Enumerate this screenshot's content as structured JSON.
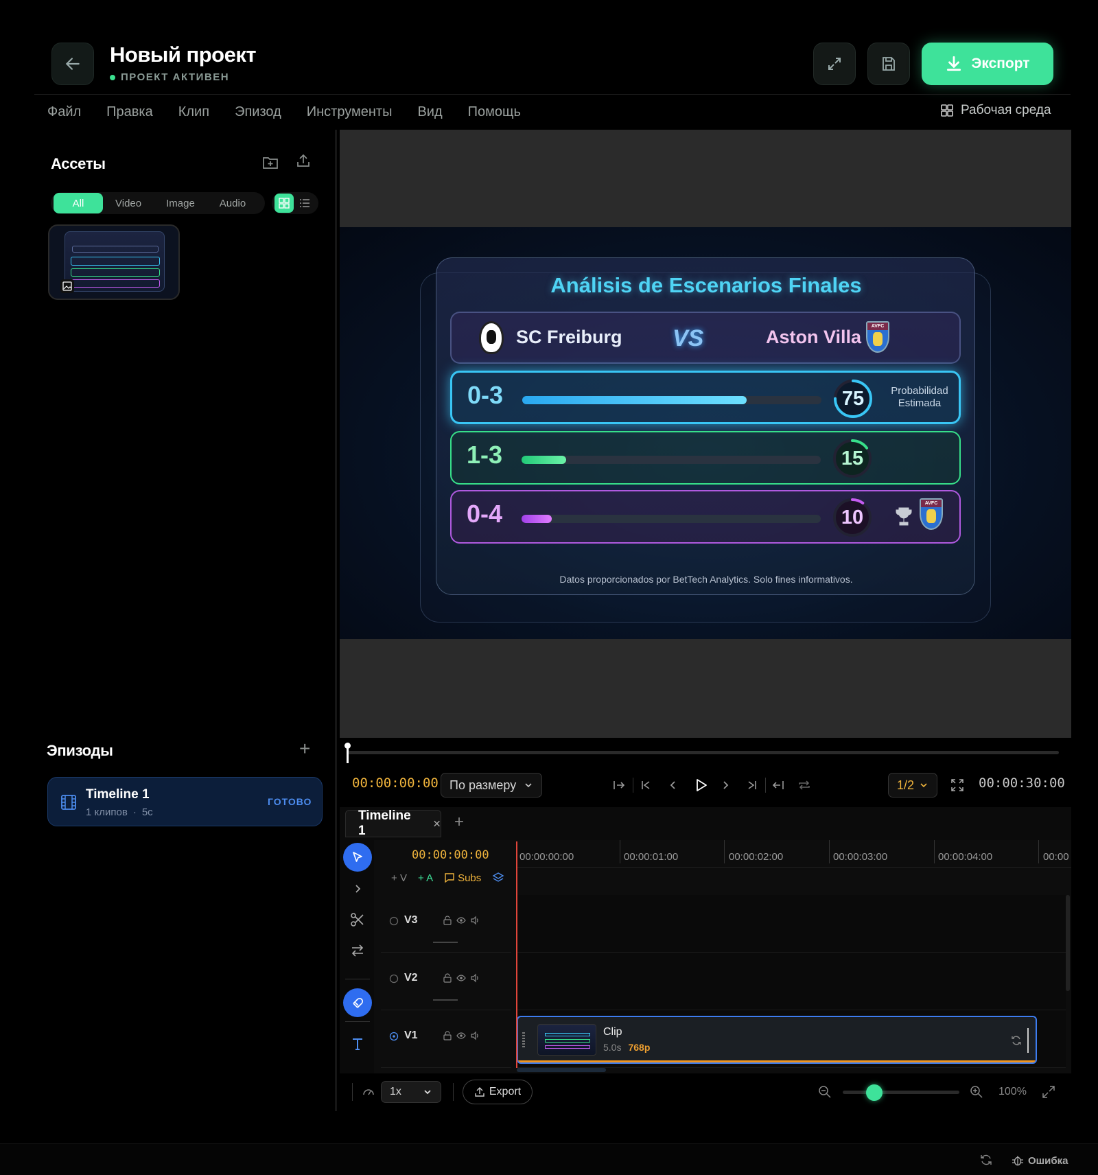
{
  "header": {
    "title": "Новый проект",
    "status": "ПРОЕКТ АКТИВЕН",
    "export_label": "Экспорт"
  },
  "menu": [
    "Файл",
    "Правка",
    "Клип",
    "Эпизод",
    "Инструменты",
    "Вид",
    "Помощь"
  ],
  "workspace_label": "Рабочая среда",
  "assets": {
    "title": "Ассеты",
    "filters": [
      "All",
      "Video",
      "Image",
      "Audio"
    ],
    "active_filter": "All"
  },
  "episodes": {
    "title": "Эпизоды",
    "item": {
      "name": "Timeline 1",
      "clips": "1 клипов",
      "duration": "5с",
      "status": "ГОТОВО"
    }
  },
  "preview": {
    "title": "Análisis de Escenarios Finales",
    "team_home": "SC Freiburg",
    "vs": "VS",
    "team_away": "Aston Villa",
    "badge_text": "AVFC",
    "scenarios": [
      {
        "score": "0-3",
        "value": 75,
        "color": "#39c6f5",
        "note": "Probabilidad Estimada"
      },
      {
        "score": "1-3",
        "value": 15,
        "color": "#37e08a",
        "note": ""
      },
      {
        "score": "0-4",
        "value": 10,
        "color": "#c45cf0",
        "note": ""
      }
    ],
    "footnote": "Datos proporcionados por BetTech Analytics. Solo fines informativos."
  },
  "transport": {
    "current_time": "00:00:00:00",
    "fit_label": "По размеру",
    "quality": "1/2",
    "total_time": "00:00:30:00"
  },
  "timeline": {
    "tab": "Timeline 1",
    "timecode": "00:00:00:00",
    "ruler": [
      "00:00:00:00",
      "00:00:01:00",
      "00:00:02:00",
      "00:00:03:00",
      "00:00:04:00",
      "00:00"
    ],
    "add_video": "V",
    "add_audio": "A",
    "subs": "Subs",
    "tracks": [
      "V3",
      "V2",
      "V1"
    ],
    "clip": {
      "name": "Clip",
      "duration": "5.0s",
      "resolution": "768p"
    }
  },
  "bottom": {
    "speed": "1x",
    "export_label": "Export",
    "zoom": "100%",
    "zoom_level": 0.27
  },
  "status": {
    "error_label": "Ошибка"
  },
  "colors": {
    "accent": "#3ee29a",
    "selection": "#3d7cf0",
    "playhead": "#e0453a",
    "timecode": "#f0b43c"
  }
}
